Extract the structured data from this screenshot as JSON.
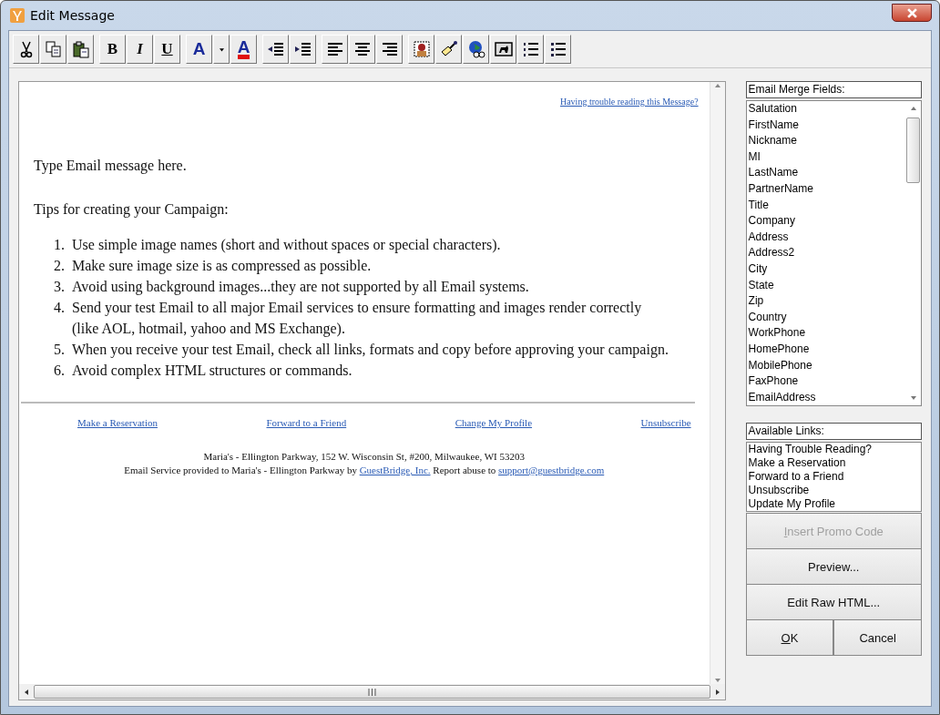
{
  "window": {
    "title": "Edit Message"
  },
  "toolbar": [
    [
      {
        "kind": "cut"
      },
      {
        "kind": "copy"
      },
      {
        "kind": "paste"
      }
    ],
    [
      {
        "kind": "bold",
        "label": "B"
      },
      {
        "kind": "italic",
        "label": "I"
      },
      {
        "kind": "underline",
        "label": "U"
      }
    ],
    [
      {
        "kind": "font-color",
        "label": "A"
      },
      {
        "kind": "dropdown"
      },
      {
        "kind": "highlight",
        "label": "A"
      }
    ],
    [
      {
        "kind": "indent"
      },
      {
        "kind": "outdent"
      }
    ],
    [
      {
        "kind": "align-left"
      },
      {
        "kind": "align-center"
      },
      {
        "kind": "align-right"
      }
    ],
    [
      {
        "kind": "person"
      },
      {
        "kind": "brush"
      },
      {
        "kind": "globe"
      },
      {
        "kind": "image"
      },
      {
        "kind": "numbered-list"
      },
      {
        "kind": "bullet-list"
      }
    ]
  ],
  "editor": {
    "top_link": "Having trouble reading this Message?",
    "intro": "Type Email message here.",
    "tips_heading": "Tips for creating your Campaign:",
    "tips": [
      {
        "number": "1.",
        "text": "Use simple image names (short and without spaces or special characters)."
      },
      {
        "number": "2.",
        "text": "Make sure image size is as compressed as possible."
      },
      {
        "number": "3.",
        "text": "Avoid using background images...they are not supported by all Email systems."
      },
      {
        "number": "4.",
        "text": "Send your test Email to all major Email services to ensure formatting and images render correctly (like AOL, hotmail, yahoo and MS Exchange)."
      },
      {
        "number": "5.",
        "text": "When you receive your test Email, check all links, formats and copy before approving your campaign."
      },
      {
        "number": "6.",
        "text": "Avoid complex HTML structures or commands."
      }
    ],
    "footer_links": [
      "Make a Reservation",
      "Forward to a Friend",
      "Change My Profile",
      "Unsubscribe"
    ],
    "address": "Maria's - Ellington Parkway, 152 W. Wisconsin St, #200, Milwaukee, WI 53203",
    "service_line": [
      {
        "kind": "text",
        "text": "Email Service provided to Maria's - Ellington Parkway by "
      },
      {
        "kind": "link",
        "text": "GuestBridge, Inc."
      },
      {
        "kind": "text",
        "text": " Report abuse to "
      },
      {
        "kind": "link",
        "text": "support@guestbridge.com"
      }
    ]
  },
  "merge_fields": {
    "label": "Email Merge Fields:",
    "items": [
      "Salutation",
      "FirstName",
      "Nickname",
      "MI",
      "LastName",
      "PartnerName",
      "Title",
      "Company",
      "Address",
      "Address2",
      "City",
      "State",
      "Zip",
      "Country",
      "WorkPhone",
      "HomePhone",
      "MobilePhone",
      "FaxPhone",
      "EmailAddress"
    ]
  },
  "available_links": {
    "label": "Available Links:",
    "items": [
      "Having Trouble Reading?",
      "Make a Reservation",
      "Forward to a Friend",
      "Unsubscribe",
      "Update My Profile"
    ]
  },
  "buttons": [
    {
      "label": "Insert Promo Code",
      "disabled": true,
      "underline_first": true
    },
    {
      "label": "Preview...",
      "disabled": false,
      "underline_first": false
    },
    {
      "label": "Edit Raw HTML...",
      "disabled": false,
      "underline_first": false
    }
  ],
  "dialog_buttons": [
    {
      "label": "OK",
      "underline_first": true
    },
    {
      "label": "Cancel",
      "underline_first": false
    }
  ]
}
